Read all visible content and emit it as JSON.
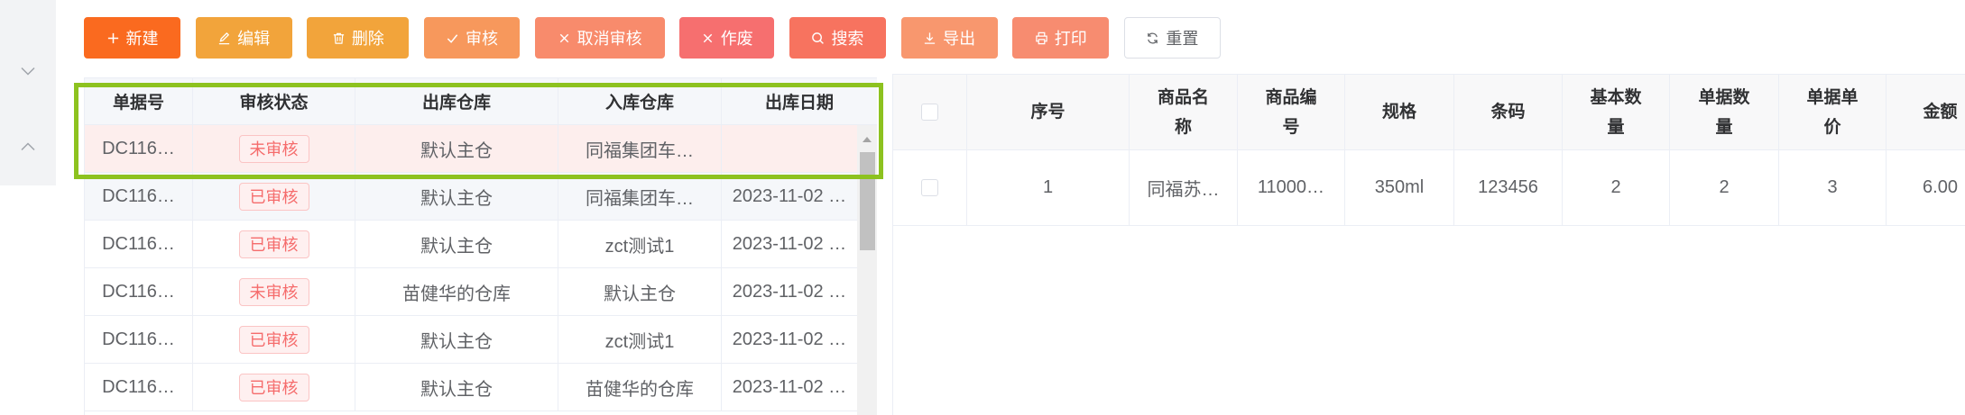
{
  "sidebar": {
    "items": [
      {
        "icon": "chevron-down-icon"
      },
      {
        "icon": "chevron-up-icon"
      }
    ]
  },
  "toolbar": {
    "buttons": [
      {
        "label": "新建",
        "icon": "plus-icon",
        "color": "#fa6a1f"
      },
      {
        "label": "编辑",
        "icon": "edit-icon",
        "color": "#f2a43b"
      },
      {
        "label": "删除",
        "icon": "trash-icon",
        "color": "#f2a43b"
      },
      {
        "label": "审核",
        "icon": "check-icon",
        "color": "#f7985c"
      },
      {
        "label": "取消审核",
        "icon": "close-icon",
        "color": "#f88b6c"
      },
      {
        "label": "作废",
        "icon": "close-icon",
        "color": "#f66f6f"
      },
      {
        "label": "搜索",
        "icon": "search-icon",
        "color": "#f7735f"
      },
      {
        "label": "导出",
        "icon": "download-icon",
        "color": "#f8976e"
      },
      {
        "label": "打印",
        "icon": "printer-icon",
        "color": "#f78c70"
      },
      {
        "label": "重置",
        "icon": "refresh-icon",
        "color": "#ffffff"
      }
    ]
  },
  "master_table": {
    "columns": [
      "单据号",
      "审核状态",
      "出库仓库",
      "入库仓库",
      "出库日期"
    ],
    "rows": [
      {
        "doc_no": "DC116…",
        "status": "未审核",
        "out_warehouse": "默认主仓",
        "in_warehouse": "同福集团车…",
        "out_date": "",
        "selected": true
      },
      {
        "doc_no": "DC116…",
        "status": "已审核",
        "out_warehouse": "默认主仓",
        "in_warehouse": "同福集团车…",
        "out_date": "2023-11-02 …"
      },
      {
        "doc_no": "DC116…",
        "status": "已审核",
        "out_warehouse": "默认主仓",
        "in_warehouse": "zct测试1",
        "out_date": "2023-11-02 …"
      },
      {
        "doc_no": "DC116…",
        "status": "未审核",
        "out_warehouse": "苗健华的仓库",
        "in_warehouse": "默认主仓",
        "out_date": "2023-11-02 …"
      },
      {
        "doc_no": "DC116…",
        "status": "已审核",
        "out_warehouse": "默认主仓",
        "in_warehouse": "zct测试1",
        "out_date": "2023-11-02 …"
      },
      {
        "doc_no": "DC116…",
        "status": "已审核",
        "out_warehouse": "默认主仓",
        "in_warehouse": "苗健华的仓库",
        "out_date": "2023-11-02 …"
      }
    ]
  },
  "detail_table": {
    "columns": [
      "序号",
      "商品名称",
      "商品编号",
      "规格",
      "条码",
      "基本数量",
      "单据数量",
      "单据单价",
      "金额"
    ],
    "rows": [
      {
        "index": "1",
        "name": "同福苏…",
        "code": "11000…",
        "spec": "350ml",
        "barcode": "123456",
        "base_qty": "2",
        "doc_qty": "2",
        "unit_price": "3",
        "amount": "6.00"
      }
    ]
  },
  "colors": {
    "highlight": "#8dc21f",
    "selected_row_bg": "#fdeeed",
    "status_tag_text": "#f56c6c",
    "status_tag_bg": "#fef0f0",
    "status_tag_border": "#fbc4c4"
  }
}
